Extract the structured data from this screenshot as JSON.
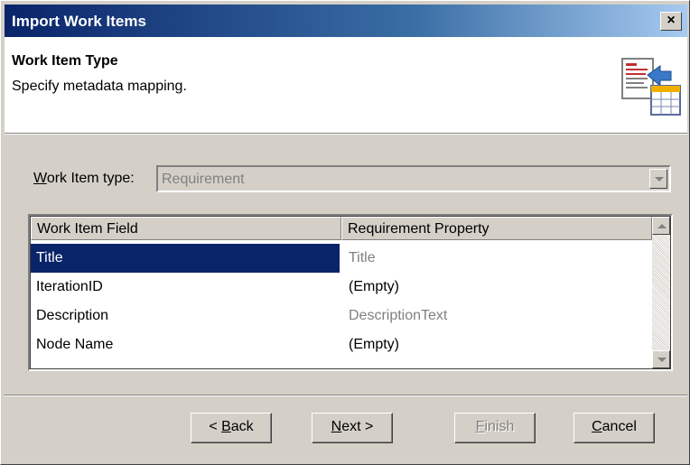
{
  "window": {
    "title": "Import Work Items",
    "close_label": "×"
  },
  "header": {
    "title": "Work Item Type",
    "subtitle": "Specify metadata mapping."
  },
  "type": {
    "label_underlined": "W",
    "label_rest": "ork Item type:",
    "value": "Requirement"
  },
  "table": {
    "columns": [
      "Work Item Field",
      "Requirement Property"
    ],
    "rows": [
      {
        "field": "Title",
        "property": "Title",
        "selected": true
      },
      {
        "field": "IterationID",
        "property": "(Empty)"
      },
      {
        "field": "Description",
        "property": "DescriptionText"
      },
      {
        "field": "Node Name",
        "property": "(Empty)"
      }
    ]
  },
  "buttons": {
    "back": {
      "pre": "< ",
      "u": "B",
      "post": "ack"
    },
    "next": {
      "pre": "",
      "u": "N",
      "post": "ext >"
    },
    "finish": {
      "pre": "",
      "u": "F",
      "post": "inish"
    },
    "cancel": {
      "pre": "",
      "u": "C",
      "post": "ancel"
    }
  },
  "colors": {
    "selection": "#0a246a",
    "muted_text": "#808080"
  }
}
